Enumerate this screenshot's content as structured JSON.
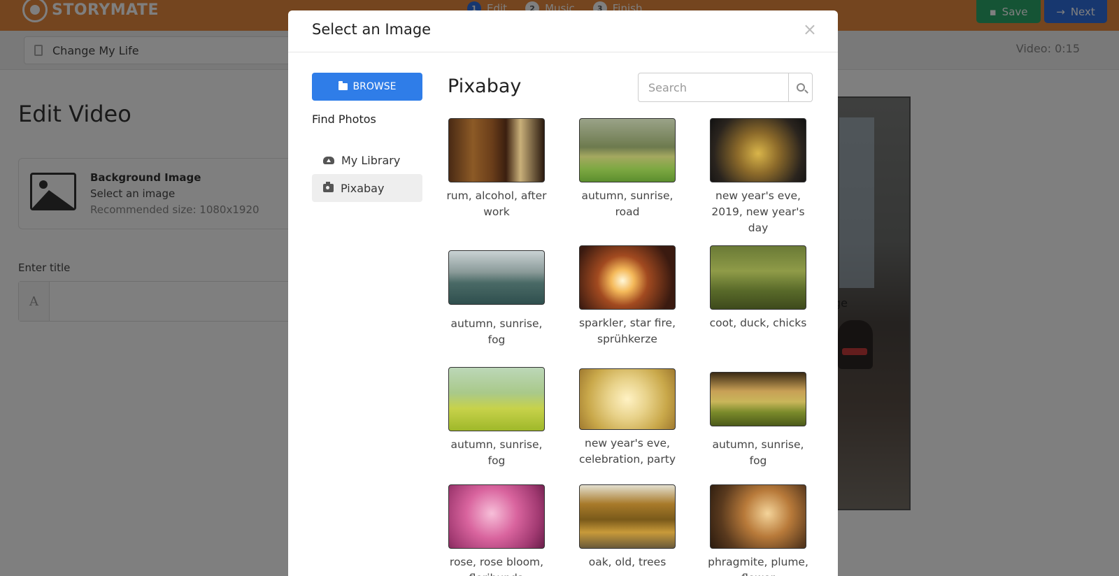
{
  "app": {
    "brand": "STORYMATE",
    "steps": [
      {
        "num": "1",
        "label": "Edit"
      },
      {
        "num": "2",
        "label": "Music"
      },
      {
        "num": "3",
        "label": "Finish"
      }
    ],
    "save_label": "Save",
    "next_label": "Next",
    "project_name": "Change My Life",
    "video_length": "Video: 0:15",
    "page_title": "Edit Video",
    "background_card": {
      "title": "Background Image",
      "subtitle": "Select an image",
      "hint": "Recommended size: 1080x1920"
    },
    "title_field": {
      "label": "Enter title",
      "prefix": "A",
      "value": ""
    },
    "preview_fragment": "ge",
    "colors": {
      "topbar": "#e98a3f",
      "save": "#2aa86a",
      "primary": "#2f6fde"
    }
  },
  "modal": {
    "title": "Select an Image",
    "close_glyph": "×",
    "browse_label": "BROWSE",
    "find_photos_label": "Find Photos",
    "sources": [
      {
        "label": "My Library",
        "icon": "cloud-upload-icon",
        "active": false
      },
      {
        "label": "Pixabay",
        "icon": "camera-icon",
        "active": true
      }
    ],
    "panel_title": "Pixabay",
    "search": {
      "placeholder": "Search",
      "value": ""
    },
    "images": [
      {
        "caption": "rum, alcohol, after work"
      },
      {
        "caption": "autumn, sunrise, road"
      },
      {
        "caption": "new year's eve, 2019, new year's day"
      },
      {
        "caption": "autumn, sunrise, fog"
      },
      {
        "caption": "sparkler, star fire, sprühkerze"
      },
      {
        "caption": "coot, duck, chicks"
      },
      {
        "caption": "autumn, sunrise, fog"
      },
      {
        "caption": "new year's eve, celebration, party"
      },
      {
        "caption": "autumn, sunrise, fog"
      },
      {
        "caption": "rose, rose bloom, floribunda"
      },
      {
        "caption": "oak, old, trees"
      },
      {
        "caption": "phragmite, plume, flower"
      }
    ]
  }
}
